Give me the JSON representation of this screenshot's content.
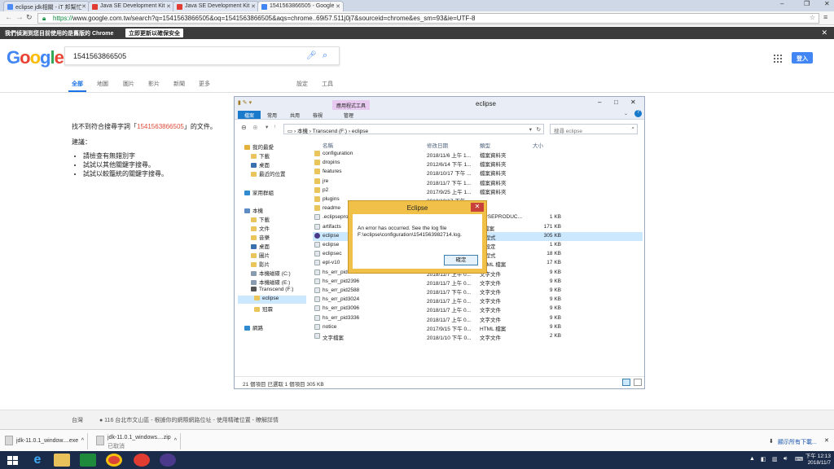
{
  "tabs": [
    {
      "label": "eclipse jdk相關 - iT 邦幫忙",
      "fav": "#4c8bf5"
    },
    {
      "label": "Java SE Development Kit",
      "fav": "#e03c31"
    },
    {
      "label": "Java SE Development Kit",
      "fav": "#e03c31"
    },
    {
      "label": "1541563866505 - Google",
      "fav": "#4285f4"
    }
  ],
  "address": {
    "scheme": "https://",
    "rest": "www.google.com.tw/search?q=1541563866505&oq=1541563866505&aqs=chrome..69i57.511j0j7&sourceid=chrome&es_sm=93&ie=UTF-8"
  },
  "infobar": {
    "message": "我們偵測到您目前使用的是舊版的 Chrome",
    "button": "立即更新以確保安全"
  },
  "google": {
    "logo_letters": [
      "G",
      "o",
      "o",
      "g",
      "l",
      "e"
    ],
    "logo_colors": [
      "#4285f4",
      "#ea4335",
      "#fbbc05",
      "#4285f4",
      "#34a853",
      "#ea4335"
    ],
    "query": "1541563866505",
    "nav": [
      "全部",
      "地圖",
      "圖片",
      "影片",
      "新聞",
      "更多",
      "設定",
      "工具"
    ],
    "login": "登入",
    "no_result_pre": "找不到符合搜尋字詞「",
    "no_result_query": "1541563866505",
    "no_result_post": "」的文件。",
    "suggest_title": "建議：",
    "suggestions": [
      "請檢查有無錯別字",
      "試試以其他關鍵字搜尋。",
      "試試以較籠統的關鍵字搜尋。"
    ]
  },
  "explorer": {
    "title": "eclipse",
    "ribbon_context": "應用程式工具",
    "ribbon_tabs": [
      "檔案",
      "常用",
      "共用",
      "檢視",
      "管理"
    ],
    "path": [
      "本機",
      "Transcend (F:)",
      "eclipse"
    ],
    "search_placeholder": "搜尋 eclipse",
    "nav": [
      {
        "label": "我的最愛",
        "type": "star"
      },
      {
        "label": "下載",
        "type": "folder"
      },
      {
        "label": "桌面",
        "type": "desk"
      },
      {
        "label": "最近的位置",
        "type": "folder"
      },
      {
        "label": "家用群組",
        "type": "group"
      },
      {
        "label": "本機",
        "type": "pc"
      },
      {
        "label": "下載",
        "type": "folder"
      },
      {
        "label": "文件",
        "type": "folder"
      },
      {
        "label": "音樂",
        "type": "folder"
      },
      {
        "label": "桌面",
        "type": "desk"
      },
      {
        "label": "圖片",
        "type": "folder"
      },
      {
        "label": "影片",
        "type": "folder"
      },
      {
        "label": "本機磁碟 (C:)",
        "type": "drive"
      },
      {
        "label": "本機磁碟 (E:)",
        "type": "drive"
      },
      {
        "label": "Transcend (F:)",
        "type": "usb"
      },
      {
        "label": "eclipse",
        "type": "folder"
      },
      {
        "label": "冠霖",
        "type": "folder"
      },
      {
        "label": "網路",
        "type": "net"
      }
    ],
    "columns": [
      "名稱",
      "修改日期",
      "類型",
      "大小"
    ],
    "files": [
      {
        "name": "configuration",
        "date": "2018/11/6 上午 1...",
        "type": "檔案資料夾",
        "size": "",
        "kind": "folder"
      },
      {
        "name": "dropins",
        "date": "2012/6/14 下午 1...",
        "type": "檔案資料夾",
        "size": "",
        "kind": "folder"
      },
      {
        "name": "features",
        "date": "2018/10/17 下午 ...",
        "type": "檔案資料夾",
        "size": "",
        "kind": "folder"
      },
      {
        "name": "jre",
        "date": "2018/11/7 下午 1...",
        "type": "檔案資料夾",
        "size": "",
        "kind": "folder"
      },
      {
        "name": "p2",
        "date": "2017/9/25 上午 1...",
        "type": "檔案資料夾",
        "size": "",
        "kind": "folder"
      },
      {
        "name": "plugins",
        "date": "2018/10/17 下午",
        "type": "",
        "size": "",
        "kind": "folder"
      },
      {
        "name": "readme",
        "date": "",
        "type": "",
        "size": "",
        "kind": "folder"
      },
      {
        "name": ".eclipsepro",
        "date": "",
        "type": "LIPSEPRODUC...",
        "size": "1 KB",
        "kind": "file"
      },
      {
        "name": "artifacts",
        "date": "",
        "type": "L 檔案",
        "size": "171 KB",
        "kind": "file"
      },
      {
        "name": "eclipse",
        "date": "",
        "type": "用程式",
        "size": "305 KB",
        "kind": "app"
      },
      {
        "name": "eclipse",
        "date": "",
        "type": "態設定",
        "size": "1 KB",
        "kind": "file"
      },
      {
        "name": "eclipsec",
        "date": "",
        "type": "用程式",
        "size": "18 KB",
        "kind": "file"
      },
      {
        "name": "epl-v10",
        "date": "",
        "type": "HTML 檔案",
        "size": "17 KB",
        "kind": "file"
      },
      {
        "name": "hs_err_pid860",
        "date": "2018/11/7 上午 0...",
        "type": "文字文件",
        "size": "9 KB",
        "kind": "file"
      },
      {
        "name": "hs_err_pid2396",
        "date": "2018/11/7 上午 0...",
        "type": "文字文件",
        "size": "9 KB",
        "kind": "file"
      },
      {
        "name": "hs_err_pid2588",
        "date": "2018/11/7 下午 0...",
        "type": "文字文件",
        "size": "9 KB",
        "kind": "file"
      },
      {
        "name": "hs_err_pid3024",
        "date": "2018/11/7 上午 0...",
        "type": "文字文件",
        "size": "9 KB",
        "kind": "file"
      },
      {
        "name": "hs_err_pid3096",
        "date": "2018/11/7 上午 0...",
        "type": "文字文件",
        "size": "9 KB",
        "kind": "file"
      },
      {
        "name": "hs_err_pid3336",
        "date": "2018/11/7 上午 0...",
        "type": "文字文件",
        "size": "9 KB",
        "kind": "file"
      },
      {
        "name": "notice",
        "date": "2017/9/15 下午 0...",
        "type": "HTML 檔案",
        "size": "9 KB",
        "kind": "file"
      },
      {
        "name": "文字檔案",
        "date": "2018/1/10 下午 0...",
        "type": "文字文件",
        "size": "2 KB",
        "kind": "file"
      }
    ],
    "status": "21 個項目      已選取 1 個項目  305 KB"
  },
  "dialog": {
    "title": "Eclipse",
    "line1": "An error has occurred. See the log file",
    "line2": "F:\\eclipse\\configuration\\1541563982714.log.",
    "ok": "確定"
  },
  "footer": {
    "country": "台灣",
    "location": "● 116 台北市文山區 - 根據你的網際網路位址 - 使用精確位置 - 瞭解詳情"
  },
  "downloads": [
    {
      "name": "jdk-11.0.1_window....exe",
      "sub": ""
    },
    {
      "name": "jdk-11.0.1_windows....zip",
      "sub": "已取消"
    }
  ],
  "downloads_all": "顯示所有下載...",
  "clock": {
    "time": "下午 12:13",
    "date": "2018/11/7"
  }
}
